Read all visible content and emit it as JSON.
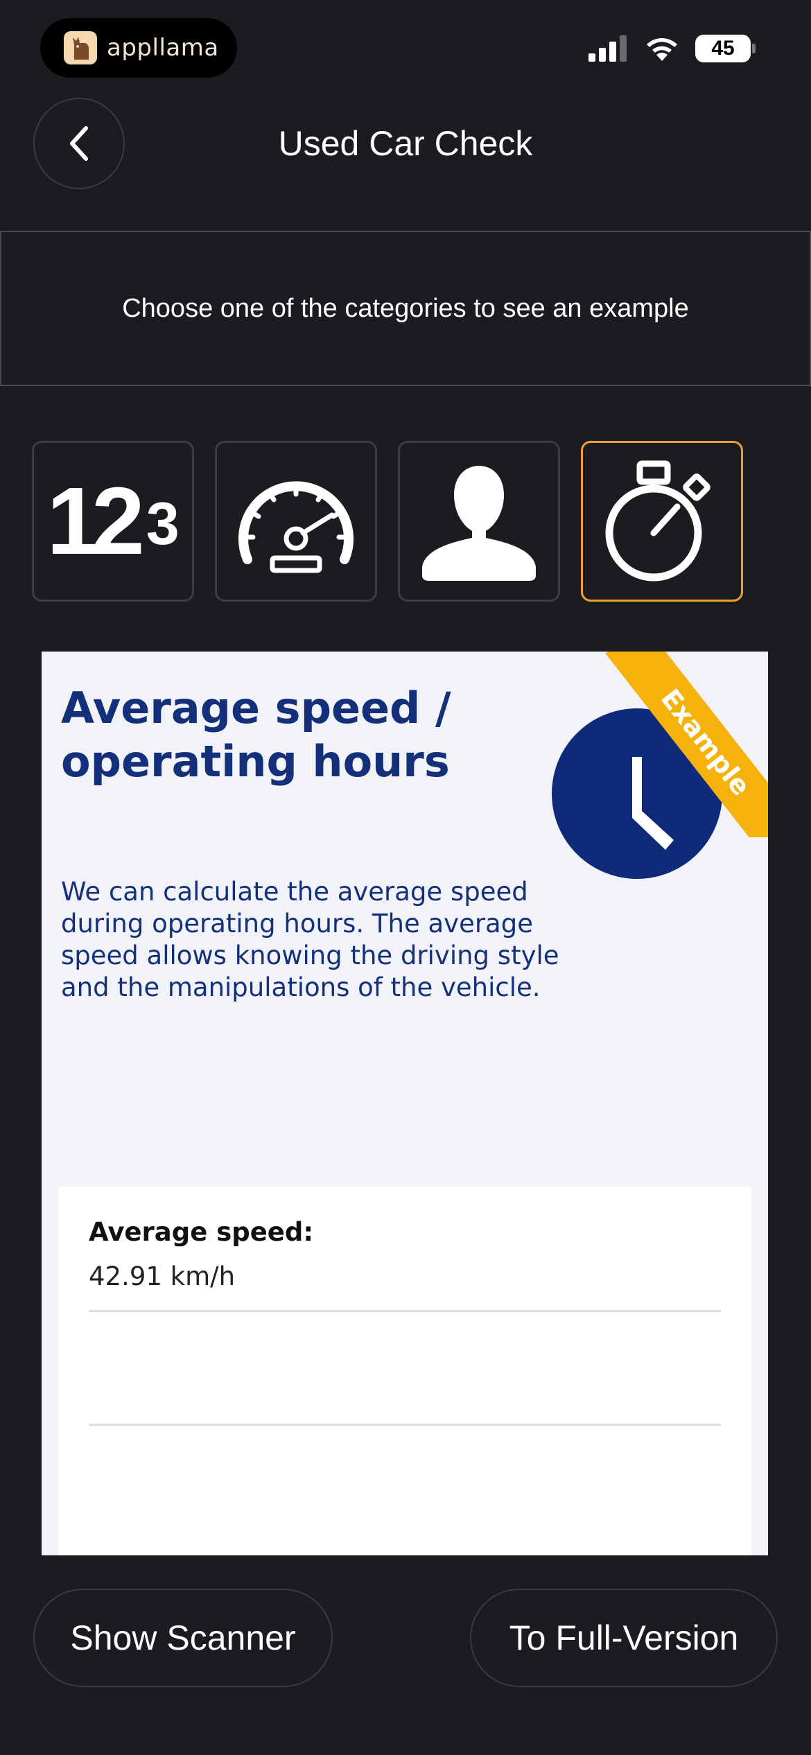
{
  "status_bar": {
    "brand_name": "appllama",
    "battery": "45"
  },
  "header": {
    "title": "Used Car Check",
    "back_icon": "chevron-left-icon"
  },
  "instruction": "Choose one of the categories to see an example",
  "categories": [
    {
      "id": "numbers",
      "icon": "numbers-123-icon",
      "glyph_1": "1",
      "glyph_2": "2",
      "glyph_3": "3",
      "active": false
    },
    {
      "id": "speedometer",
      "icon": "speedometer-icon",
      "active": false
    },
    {
      "id": "person",
      "icon": "person-icon",
      "active": false
    },
    {
      "id": "stopwatch",
      "icon": "stopwatch-icon",
      "active": true
    }
  ],
  "card": {
    "title": "Average speed / operating hours",
    "ribbon": "Example",
    "description": "We can calculate the average speed during operating hours. The average speed allows knowing the driving style and the manipulations of the vehicle.",
    "result_label": "Average speed:",
    "result_value": "42.91 km/h"
  },
  "buttons": {
    "show_scanner": "Show Scanner",
    "full_version": "To Full-Version"
  },
  "colors": {
    "background": "#1b1c20",
    "accent": "#f0a030",
    "card_navy": "#15307a",
    "ribbon": "#f6b20c"
  }
}
